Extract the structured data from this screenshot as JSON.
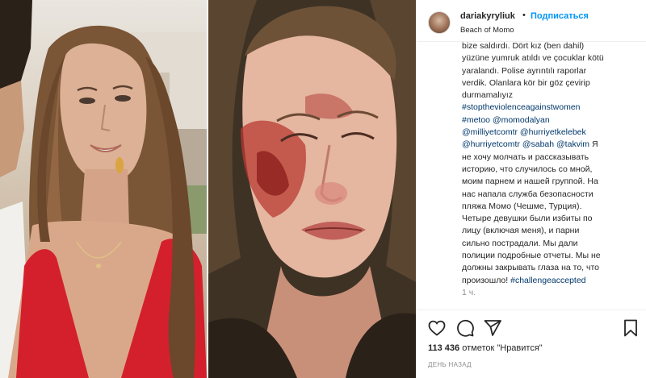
{
  "post": {
    "username": "dariakyryliuk",
    "dot": "•",
    "follow_label": "Подписаться",
    "location": "Beach of Momo",
    "caption_lines": [
      {
        "parts": [
          {
            "t": "bize saldırdı. Dört kız (ben dahil)",
            "c": ""
          }
        ]
      },
      {
        "parts": [
          {
            "t": "yüzüne yumruk atıldı ve çocuklar kötü",
            "c": ""
          }
        ]
      },
      {
        "parts": [
          {
            "t": "yaralandı. Polise ayrıntılı raporlar",
            "c": ""
          }
        ]
      },
      {
        "parts": [
          {
            "t": "verdik. Olanlara kör bir göz çevirip",
            "c": ""
          }
        ]
      },
      {
        "parts": [
          {
            "t": "durmamalıyız",
            "c": ""
          }
        ]
      },
      {
        "parts": [
          {
            "t": "#stoptheviolenceagainstwomen",
            "c": "tag"
          }
        ]
      },
      {
        "parts": [
          {
            "t": "#metoo @momodalyan",
            "c": "tag"
          }
        ]
      },
      {
        "parts": [
          {
            "t": "@milliyetcomtr @hurriyetkelebek",
            "c": "tag"
          }
        ]
      },
      {
        "parts": [
          {
            "t": "@hurriyetcomtr @sabah @takvim",
            "c": "tag"
          },
          {
            "t": " Я",
            "c": ""
          }
        ]
      },
      {
        "parts": [
          {
            "t": "не хочу молчать и рассказывать",
            "c": ""
          }
        ]
      },
      {
        "parts": [
          {
            "t": "историю, что случилось со мной,",
            "c": ""
          }
        ]
      },
      {
        "parts": [
          {
            "t": "моим парнем и нашей группой. На",
            "c": ""
          }
        ]
      },
      {
        "parts": [
          {
            "t": "нас напала служба безопасности",
            "c": ""
          }
        ]
      },
      {
        "parts": [
          {
            "t": "пляжа Момо (Чешме, Турция).",
            "c": ""
          }
        ]
      },
      {
        "parts": [
          {
            "t": "Четыре девушки были избиты по",
            "c": ""
          }
        ]
      },
      {
        "parts": [
          {
            "t": "лицу (включая меня), и парни",
            "c": ""
          }
        ]
      },
      {
        "parts": [
          {
            "t": "сильно пострадали. Мы дали",
            "c": ""
          }
        ]
      },
      {
        "parts": [
          {
            "t": "полиции подробные отчеты. Мы не",
            "c": ""
          }
        ]
      },
      {
        "parts": [
          {
            "t": "должны закрывать глаза на то, что",
            "c": ""
          }
        ]
      },
      {
        "parts": [
          {
            "t": "произошло! ",
            "c": ""
          },
          {
            "t": "#challengeaccepted",
            "c": "tag"
          }
        ]
      },
      {
        "parts": [
          {
            "t": "1 ч.",
            "c": "faded"
          }
        ]
      }
    ],
    "likes_count": "113 436",
    "likes_text": " отметок \"Нравится\"",
    "time_ago": "ДЕНЬ НАЗАД"
  },
  "icons": {
    "like": "heart-icon",
    "comment": "comment-icon",
    "share": "share-icon",
    "save": "bookmark-icon"
  },
  "colors": {
    "link": "#0095f6",
    "hashtag": "#00376b",
    "muted": "#8e8e8e",
    "text": "#262626"
  }
}
